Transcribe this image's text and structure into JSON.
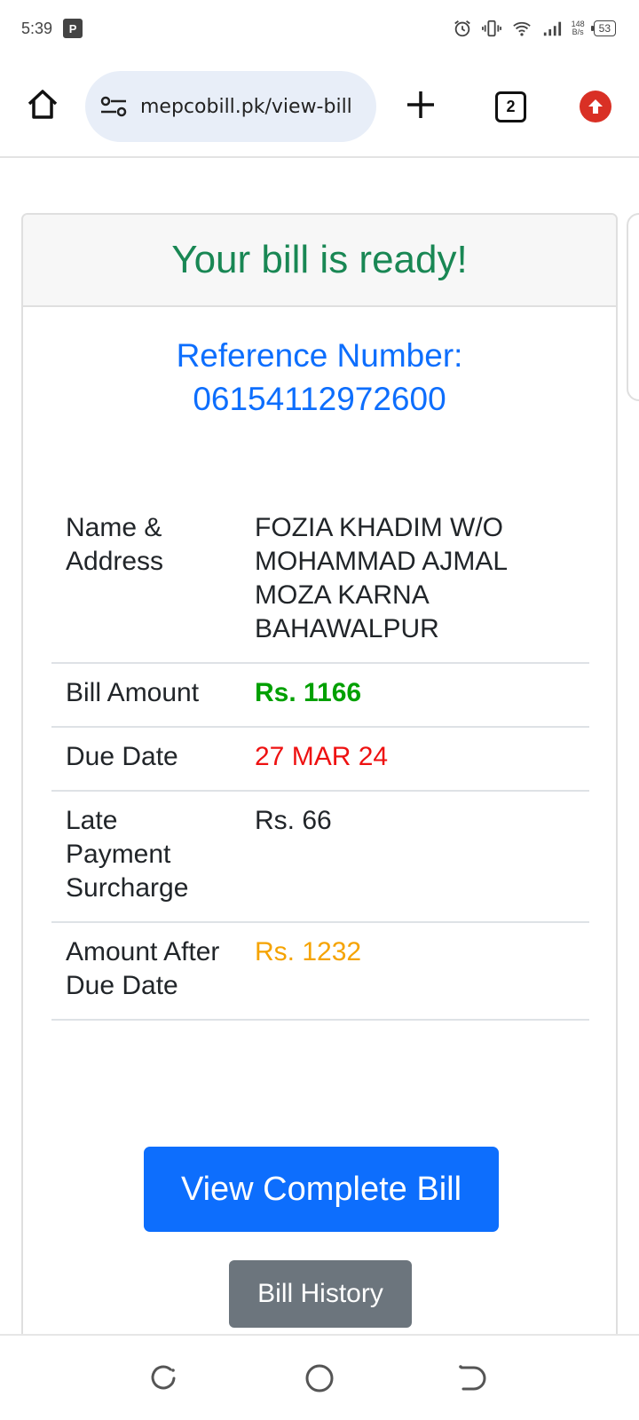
{
  "status_bar": {
    "time": "5:39",
    "net_speed_value": "148",
    "net_speed_unit": "B/s",
    "battery": "53"
  },
  "browser": {
    "url": "mepcobill.pk/view-bill",
    "tab_count": "2"
  },
  "card": {
    "title": "Your bill is ready!",
    "reference_label": "Reference Number:",
    "reference_number": "06154112972600"
  },
  "bill": {
    "rows": [
      {
        "label": "Name & Address",
        "value": "FOZIA KHADIM W/O MOHAMMAD AJMAL MOZA KARNA BAHAWALPUR"
      },
      {
        "label": "Bill Amount",
        "value": "Rs. 1166"
      },
      {
        "label": "Due Date",
        "value": "27 MAR 24"
      },
      {
        "label": "Late Payment Surcharge",
        "value": "Rs. 66"
      },
      {
        "label": "Amount After Due Date",
        "value": "Rs. 1232"
      }
    ]
  },
  "buttons": {
    "view_complete_bill": "View Complete Bill",
    "bill_history": "Bill History"
  },
  "colors": {
    "title_green": "#198754",
    "reference_blue": "#0d6efd",
    "bill_amount_green": "#00a000",
    "due_date_red": "#ee1111",
    "after_due_orange": "#f5a300",
    "primary_button": "#0d6efd",
    "secondary_button": "#6c757d"
  }
}
